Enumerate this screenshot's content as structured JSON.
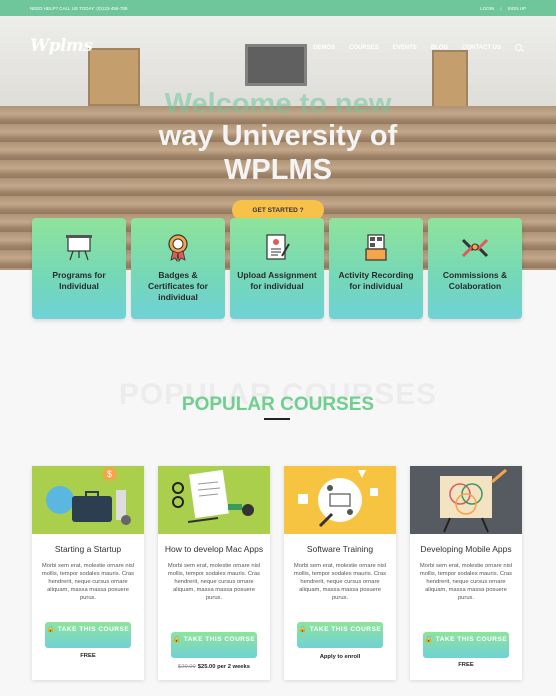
{
  "topbar": {
    "contact": "NEED HELP? CALL US TODAY: (0)123-456-789",
    "login": "LOGIN",
    "sep": "|",
    "signup": "SIGN UP"
  },
  "logo": "Wplms",
  "nav": [
    "DEMOS",
    "COURSES",
    "EVENTS",
    "BLOG",
    "CONTACT US"
  ],
  "hero": {
    "line1": "Welcome to new",
    "line2": "way University of",
    "line3": "WPLMS",
    "cta": "GET STARTED ?"
  },
  "features": [
    {
      "label": "Programs for Individual",
      "icon": "presentation-board-icon"
    },
    {
      "label": "Badges & Certificates for individual",
      "icon": "badge-icon"
    },
    {
      "label": "Upload Assignment for individual",
      "icon": "document-upload-icon"
    },
    {
      "label": "Activity Recording for individual",
      "icon": "recording-icon"
    },
    {
      "label": "Commissions & Colaboration",
      "icon": "handshake-icon"
    }
  ],
  "section": {
    "ghost": "POPULAR COURSES",
    "title": "POPULAR COURSES"
  },
  "courses": [
    {
      "title": "Starting a Startup",
      "desc": "Morbi sem erat, molestie ornare nisl mollis, tempor sodales mauris. Cras hendrerit, neque cursus ornare aliquam, massa massa posuere purus.",
      "button": "TAKE THIS COURSE",
      "price": "FREE",
      "old_price": ""
    },
    {
      "title": "How to develop Mac Apps",
      "desc": "Morbi sem erat, molestie ornare nisl mollis, tempor sodales mauris. Cras hendrerit, neque cursus ornare aliquam, massa massa posuere purus.",
      "button": "TAKE THIS COURSE",
      "price": "$25.00 per 2 weeks",
      "old_price": "$29.00"
    },
    {
      "title": "Software Training",
      "desc": "Morbi sem erat, molestie ornare nisl mollis, tempor sodales mauris. Cras hendrerit, neque cursus ornare aliquam, massa massa posuere purus.",
      "button": "TAKE THIS COURSE",
      "price": "Apply to enroll",
      "old_price": ""
    },
    {
      "title": "Developing Mobile Apps",
      "desc": "Morbi sem erat, molestie ornare nisl mollis, tempor sodales mauris. Cras hendrerit, neque cursus ornare aliquam, massa massa posuere purus.",
      "button": "TAKE THIS COURSE",
      "price": "FREE",
      "old_price": ""
    }
  ],
  "colors": {
    "accent": "#6fc69b",
    "cta": "#f7c14a",
    "title_green": "#6fcf8f"
  }
}
